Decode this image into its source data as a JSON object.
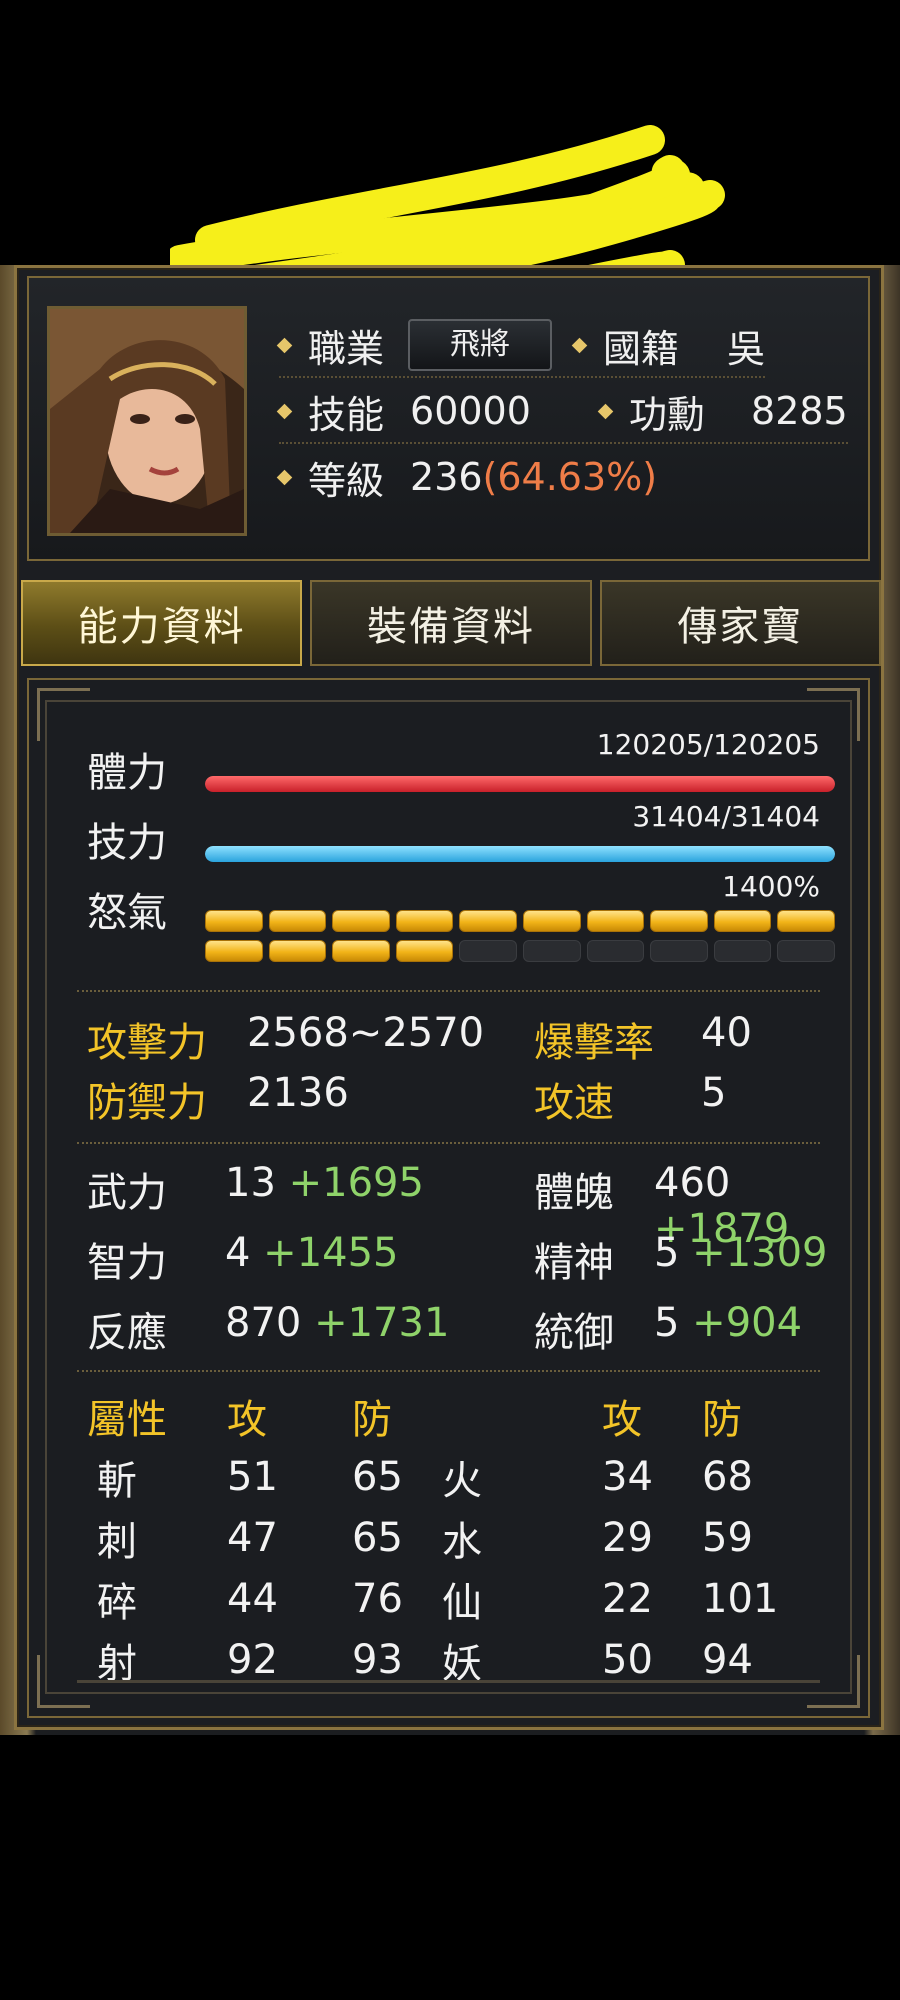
{
  "colors": {
    "gold": "#f3c428",
    "green": "#8fd36a",
    "orange": "#ef7d48",
    "hp": "#e03a40",
    "mp": "#3ab6ee",
    "redaction": "#f6ef1a"
  },
  "header": {
    "job_label": "職業",
    "job_value": "飛將",
    "nation_label": "國籍",
    "nation_value": "吳",
    "skill_label": "技能",
    "skill_value": "60000",
    "merit_label": "功勳",
    "merit_value": "8285",
    "level_label": "等級",
    "level_value": "236",
    "level_percent": "(64.63%)"
  },
  "tabs": [
    {
      "label": "能力資料",
      "active": true
    },
    {
      "label": "裝備資料",
      "active": false
    },
    {
      "label": "傳家寶",
      "active": false
    }
  ],
  "bars": {
    "hp": {
      "label": "體力",
      "value": "120205/120205",
      "fraction": 1.0
    },
    "mp": {
      "label": "技力",
      "value": "31404/31404",
      "fraction": 1.0
    },
    "rage": {
      "label": "怒氣",
      "value": "1400%",
      "segments_total": 20,
      "segments_filled": 14
    }
  },
  "combat": {
    "attack_label": "攻擊力",
    "attack_value": "2568~2570",
    "crit_label": "爆擊率",
    "crit_value": "40",
    "defense_label": "防禦力",
    "defense_value": "2136",
    "speed_label": "攻速",
    "speed_value": "5"
  },
  "attributes": {
    "str_label": "武力",
    "str_base": "13",
    "str_bonus": "+1695",
    "con_label": "體魄",
    "con_base": "460",
    "con_bonus": "+1879",
    "int_label": "智力",
    "int_base": "4",
    "int_bonus": "+1455",
    "spi_label": "精神",
    "spi_base": "5",
    "spi_bonus": "+1309",
    "agi_label": "反應",
    "agi_base": "870",
    "agi_bonus": "+1731",
    "cmd_label": "統御",
    "cmd_base": "5",
    "cmd_bonus": "+904"
  },
  "elements": {
    "header": [
      "屬性",
      "攻",
      "防",
      "",
      "攻",
      "防"
    ],
    "rows": [
      [
        "斬",
        "51",
        "65",
        "火",
        "34",
        "68"
      ],
      [
        "刺",
        "47",
        "65",
        "水",
        "29",
        "59"
      ],
      [
        "碎",
        "44",
        "76",
        "仙",
        "22",
        "101"
      ],
      [
        "射",
        "92",
        "93",
        "妖",
        "50",
        "94"
      ]
    ]
  }
}
